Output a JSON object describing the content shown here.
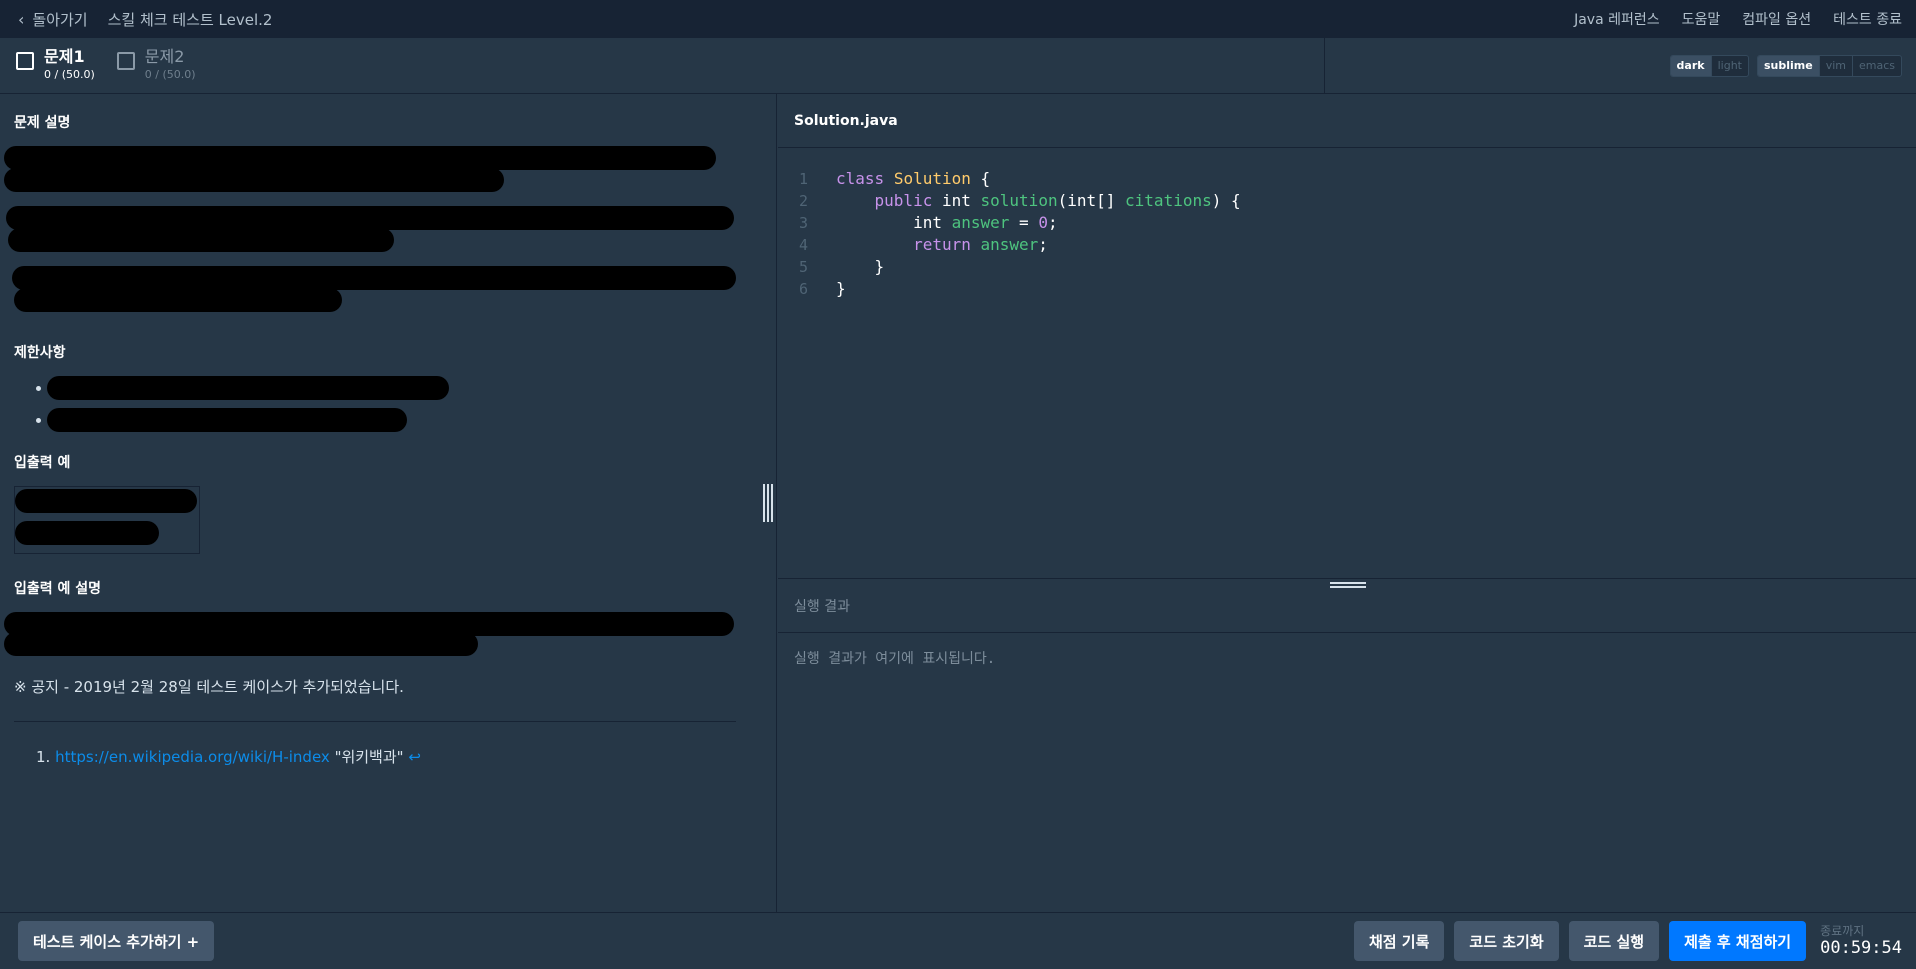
{
  "header": {
    "back_label": "돌아가기",
    "title": "스킬 체크 테스트 Level.2",
    "links": [
      "Java 레퍼런스",
      "도움말",
      "컴파일 옵션",
      "테스트 종료"
    ]
  },
  "tabs": [
    {
      "name": "문제1",
      "score": "0 / (50.0)"
    },
    {
      "name": "문제2",
      "score": "0 / (50.0)"
    }
  ],
  "theme": {
    "options": [
      "dark",
      "light"
    ],
    "selected": "dark"
  },
  "keymap": {
    "options": [
      "sublime",
      "vim",
      "emacs"
    ],
    "selected": "sublime"
  },
  "problem": {
    "section_description": "문제 설명",
    "section_constraints": "제한사항",
    "section_io": "입출력 예",
    "section_io_explain": "입출력 예 설명",
    "notice": "※ 공지 - 2019년 2월 28일 테스트 케이스가 추가되었습니다.",
    "footnote_number": "1.",
    "footnote_link": "https://en.wikipedia.org/wiki/H-index",
    "footnote_text": "\"위키백과\"",
    "footnote_return": "↩"
  },
  "editor": {
    "filename": "Solution.java",
    "line_numbers": [
      "1",
      "2",
      "3",
      "4",
      "5",
      "6"
    ]
  },
  "result": {
    "title": "실행 결과",
    "placeholder": "실행 결과가 여기에 표시됩니다."
  },
  "footer": {
    "add_testcase": "테스트 케이스 추가하기 +",
    "history": "채점 기록",
    "reset": "코드 초기화",
    "run": "코드 실행",
    "submit": "제출 후 채점하기",
    "timer_label": "종료까지",
    "timer_value": "00:59:54"
  }
}
